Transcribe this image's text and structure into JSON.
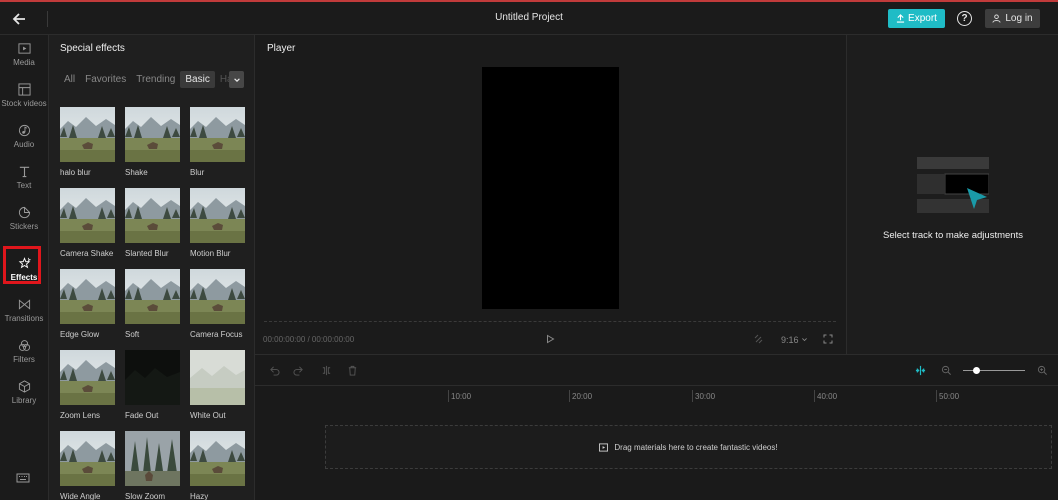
{
  "topbar": {
    "title": "Untitled Project",
    "export_label": "Export",
    "help_label": "?",
    "login_label": "Log in"
  },
  "colors": {
    "accent": "#1fbcc6",
    "highlight_box": "#e0161c",
    "top_border": "#c23b3b"
  },
  "rail": {
    "items": [
      {
        "label": "Media",
        "icon": "media-icon"
      },
      {
        "label": "Stock videos",
        "icon": "stock-videos-icon"
      },
      {
        "label": "Audio",
        "icon": "audio-icon"
      },
      {
        "label": "Text",
        "icon": "text-icon"
      },
      {
        "label": "Stickers",
        "icon": "stickers-icon"
      },
      {
        "label": "Effects",
        "icon": "effects-icon",
        "active": true
      },
      {
        "label": "Transitions",
        "icon": "transitions-icon"
      },
      {
        "label": "Filters",
        "icon": "filters-icon"
      },
      {
        "label": "Library",
        "icon": "library-icon"
      }
    ]
  },
  "effects": {
    "title": "Special effects",
    "tabs": [
      "All",
      "Favorites",
      "Trending",
      "Basic",
      "Ha"
    ],
    "selected_tab": "Basic",
    "items": [
      {
        "label": "halo blur",
        "style": "mountain"
      },
      {
        "label": "Shake",
        "style": "mountain"
      },
      {
        "label": "Blur",
        "style": "mountain"
      },
      {
        "label": "Camera Shake",
        "style": "mountain"
      },
      {
        "label": "Slanted Blur",
        "style": "mountain"
      },
      {
        "label": "Motion Blur",
        "style": "mountain"
      },
      {
        "label": "Edge Glow",
        "style": "mountain"
      },
      {
        "label": "Soft",
        "style": "mountain"
      },
      {
        "label": "Camera Focus",
        "style": "mountain"
      },
      {
        "label": "Zoom Lens",
        "style": "mountain"
      },
      {
        "label": "Fade Out",
        "style": "dark"
      },
      {
        "label": "White Out",
        "style": "white"
      },
      {
        "label": "Wide Angle",
        "style": "mountain"
      },
      {
        "label": "Slow Zoom",
        "style": "forest"
      },
      {
        "label": "Hazy",
        "style": "mountain"
      }
    ]
  },
  "player": {
    "title": "Player",
    "timecode": "00:00:00:00 / 00:00:00:00",
    "ratio": "9:16"
  },
  "props": {
    "message": "Select track to make adjustments"
  },
  "timeline": {
    "ticks": [
      "10:00",
      "20:00",
      "30:00",
      "40:00",
      "50:00"
    ],
    "drop_message": "Drag materials here to create fantastic videos!"
  }
}
